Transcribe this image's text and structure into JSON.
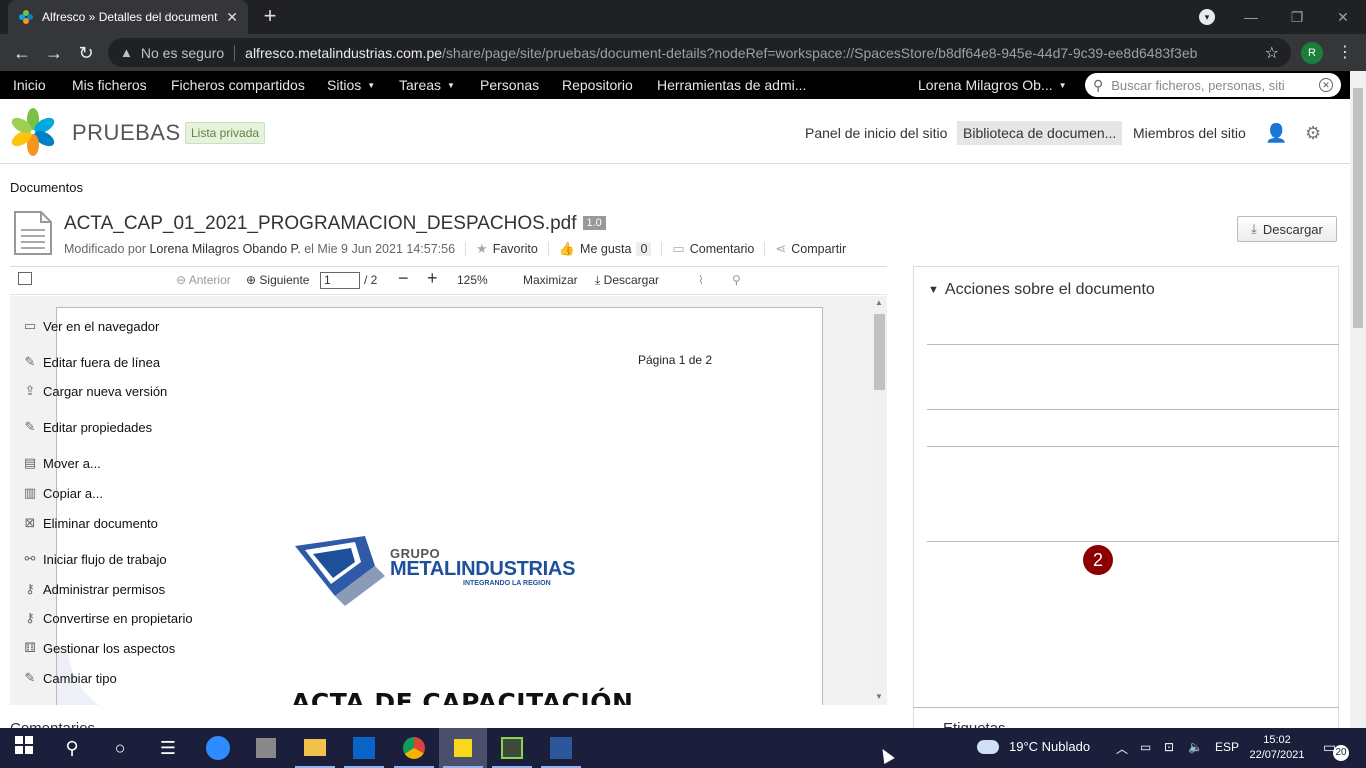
{
  "browser": {
    "tab_title": "Alfresco » Detalles del document",
    "security_label": "No es seguro",
    "url_host": "alfresco.metalindustrias.com.pe",
    "url_path": "/share/page/site/pruebas/document-details?nodeRef=workspace://SpacesStore/b8df64e8-945e-44d7-9c39-ee8d6483f3eb",
    "profile_initial": "R"
  },
  "appnav": {
    "items": [
      "Inicio",
      "Mis ficheros",
      "Ficheros compartidos",
      "Sitios",
      "Tareas",
      "Personas",
      "Repositorio",
      "Herramientas de admi..."
    ],
    "user": "Lorena Milagros Ob...",
    "search_placeholder": "Buscar ficheros, personas, siti"
  },
  "site": {
    "title": "PRUEBAS",
    "visibility": "Lista privada",
    "nav": [
      "Panel de inicio del sitio",
      "Biblioteca de documen...",
      "Miembros del sitio"
    ]
  },
  "breadcrumb": "Documentos",
  "document": {
    "name": "ACTA_CAP_01_2021_PROGRAMACION_DESPACHOS.pdf",
    "version": "1.0",
    "modified_prefix": "Modificado por",
    "modified_by": "Lorena Milagros Obando P.",
    "modified_on": "el Mie 9 Jun 2021 14:57:56",
    "favorite_label": "Favorito",
    "like_label": "Me gusta",
    "like_count": "0",
    "comment_label": "Comentario",
    "share_label": "Compartir",
    "download_label": "Descargar"
  },
  "viewer": {
    "prev": "Anterior",
    "next": "Siguiente",
    "page_current": "1",
    "page_total": "/ 2",
    "zoom": "125%",
    "maximize": "Maximizar",
    "download": "Descargar",
    "page_label": "Página 1 de 2",
    "logo_grupo": "GRUPO",
    "logo_name": "METALINDUSTRIAS",
    "logo_tagline": "INTEGRANDO LA REGION",
    "heading": "ACTA DE CAPACITACIÓN"
  },
  "comments_title": "Comentarios",
  "actions": {
    "title": "Acciones sobre el documento",
    "items": [
      "Ver en el navegador",
      "Editar fuera de línea",
      "Cargar nueva versión",
      "Editar propiedades",
      "Mover a...",
      "Copiar a...",
      "Eliminar documento",
      "Iniciar flujo de trabajo",
      "Administrar permisos",
      "Convertirse en propietario",
      "Gestionar los aspectos",
      "Cambiar tipo"
    ],
    "step_badge": "2"
  },
  "tags_title": "Etiquetas",
  "taskbar": {
    "weather": "19°C  Nublado",
    "lang": "ESP",
    "time": "15:02",
    "date": "22/07/2021",
    "notifications": "20"
  }
}
